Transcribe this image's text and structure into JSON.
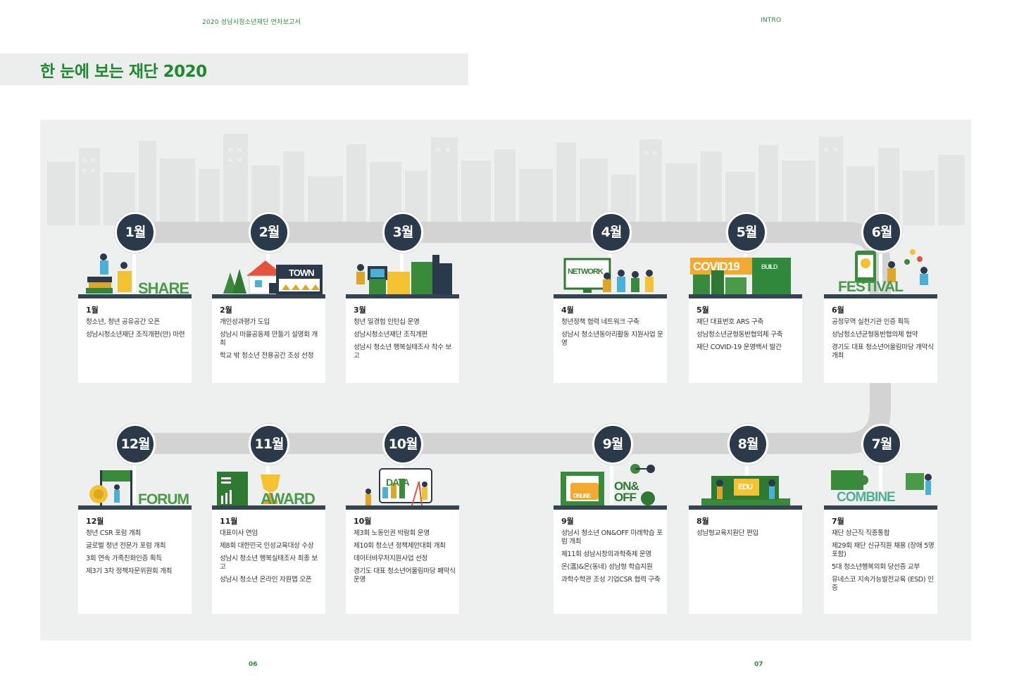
{
  "header": {
    "left": "2020 성남시청소년재단 연차보고서",
    "right": "INTRO"
  },
  "title": "한 눈에 보는 재단 2020",
  "pages": {
    "left": "06",
    "right": "07"
  },
  "colors": {
    "accent_green": "#1e8a2c",
    "badge_navy": "#2b3a4a",
    "road_gray": "#d3d3d3",
    "panel": "#eef0ef"
  },
  "months": [
    {
      "badge": "1월",
      "label": "1월",
      "word": "SHARE",
      "items": [
        "청소년, 청년 공유공간 오픈",
        "성남시청소년재단 조직개편(안) 마련"
      ]
    },
    {
      "badge": "2월",
      "label": "2월",
      "word": "TOWN",
      "items": [
        "개인성과평가 도입",
        "성남시 마을공동체 만들기 설명회 개최",
        "학교 밖 청소년 전용공간 조성 선정"
      ]
    },
    {
      "badge": "3월",
      "label": "3월",
      "word": "",
      "items": [
        "청년 일경험 인턴십 운영",
        "성남시청소년재단 조직개편",
        "성남시 청소년 행복실태조사 착수 보고"
      ]
    },
    {
      "badge": "4월",
      "label": "4월",
      "word": "NETWORK",
      "items": [
        "청년정책 협력 네트워크 구축",
        "성남시 청소년동아리활동 지원사업 운영"
      ]
    },
    {
      "badge": "5월",
      "label": "5월",
      "word": "COVID19",
      "word2": "BUILD",
      "items": [
        "재단 대표번호 ARS 구축",
        "성남청소년균형동반협의체 구축",
        "재단 COVID-19 운영백서 발간"
      ]
    },
    {
      "badge": "6월",
      "label": "6월",
      "word": "FESTIVAL",
      "items": [
        "공정무역 실천기관 인증 획득",
        "성남청소년균형동반협의체 협약",
        "경기도 대표 청소년어울림마당 개막식 개최"
      ]
    },
    {
      "badge": "7월",
      "label": "7월",
      "word": "COMBINE",
      "items": [
        "재단 상근직 직종통합",
        "제29회 재단 신규직원 채용 (장애 5명 포함)",
        "5대 청소년행복의회 당선증 교부",
        "유네스코 지속가능발전교육 (ESD) 인증"
      ]
    },
    {
      "badge": "8월",
      "label": "8월",
      "word": "EDU",
      "items": [
        "성남형교육지원단 편입"
      ]
    },
    {
      "badge": "9월",
      "label": "9월",
      "word": "ON&OFF",
      "word2": "ONLINE",
      "items": [
        "성남시 청소년 ON&OFF 미래학습 포럼 개최",
        "제11회 성남시창의과학축제 운영",
        "온(溫)&온(동네) 성남형 학습지원",
        "과학수학관 조성 기업CSR 협력 구축"
      ]
    },
    {
      "badge": "10월",
      "label": "10월",
      "word": "DATA",
      "items": [
        "제3회 노동인권 박람회 운영",
        "제10회 청소년 정책제안대회 개최",
        "데이터바우처지원사업 선정",
        "경기도 대표 청소년어울림마당 폐막식 운영"
      ]
    },
    {
      "badge": "11월",
      "label": "11월",
      "word": "AWARD",
      "items": [
        "대표이사 연임",
        "제8회 대한민국 인성교육대상 수상",
        "성남시 청소년 행복실태조사 최종 보고",
        "성남시 청소년 온라인 자원맵 오픈"
      ]
    },
    {
      "badge": "12월",
      "label": "12월",
      "word": "FORUM",
      "items": [
        "청년 CSR 포럼 개최",
        "글로벌 청년 전문가 포럼 개최",
        "3회 연속 가족친화인증 획득",
        "제3기 3차 정책자문위원회 개최"
      ]
    }
  ]
}
